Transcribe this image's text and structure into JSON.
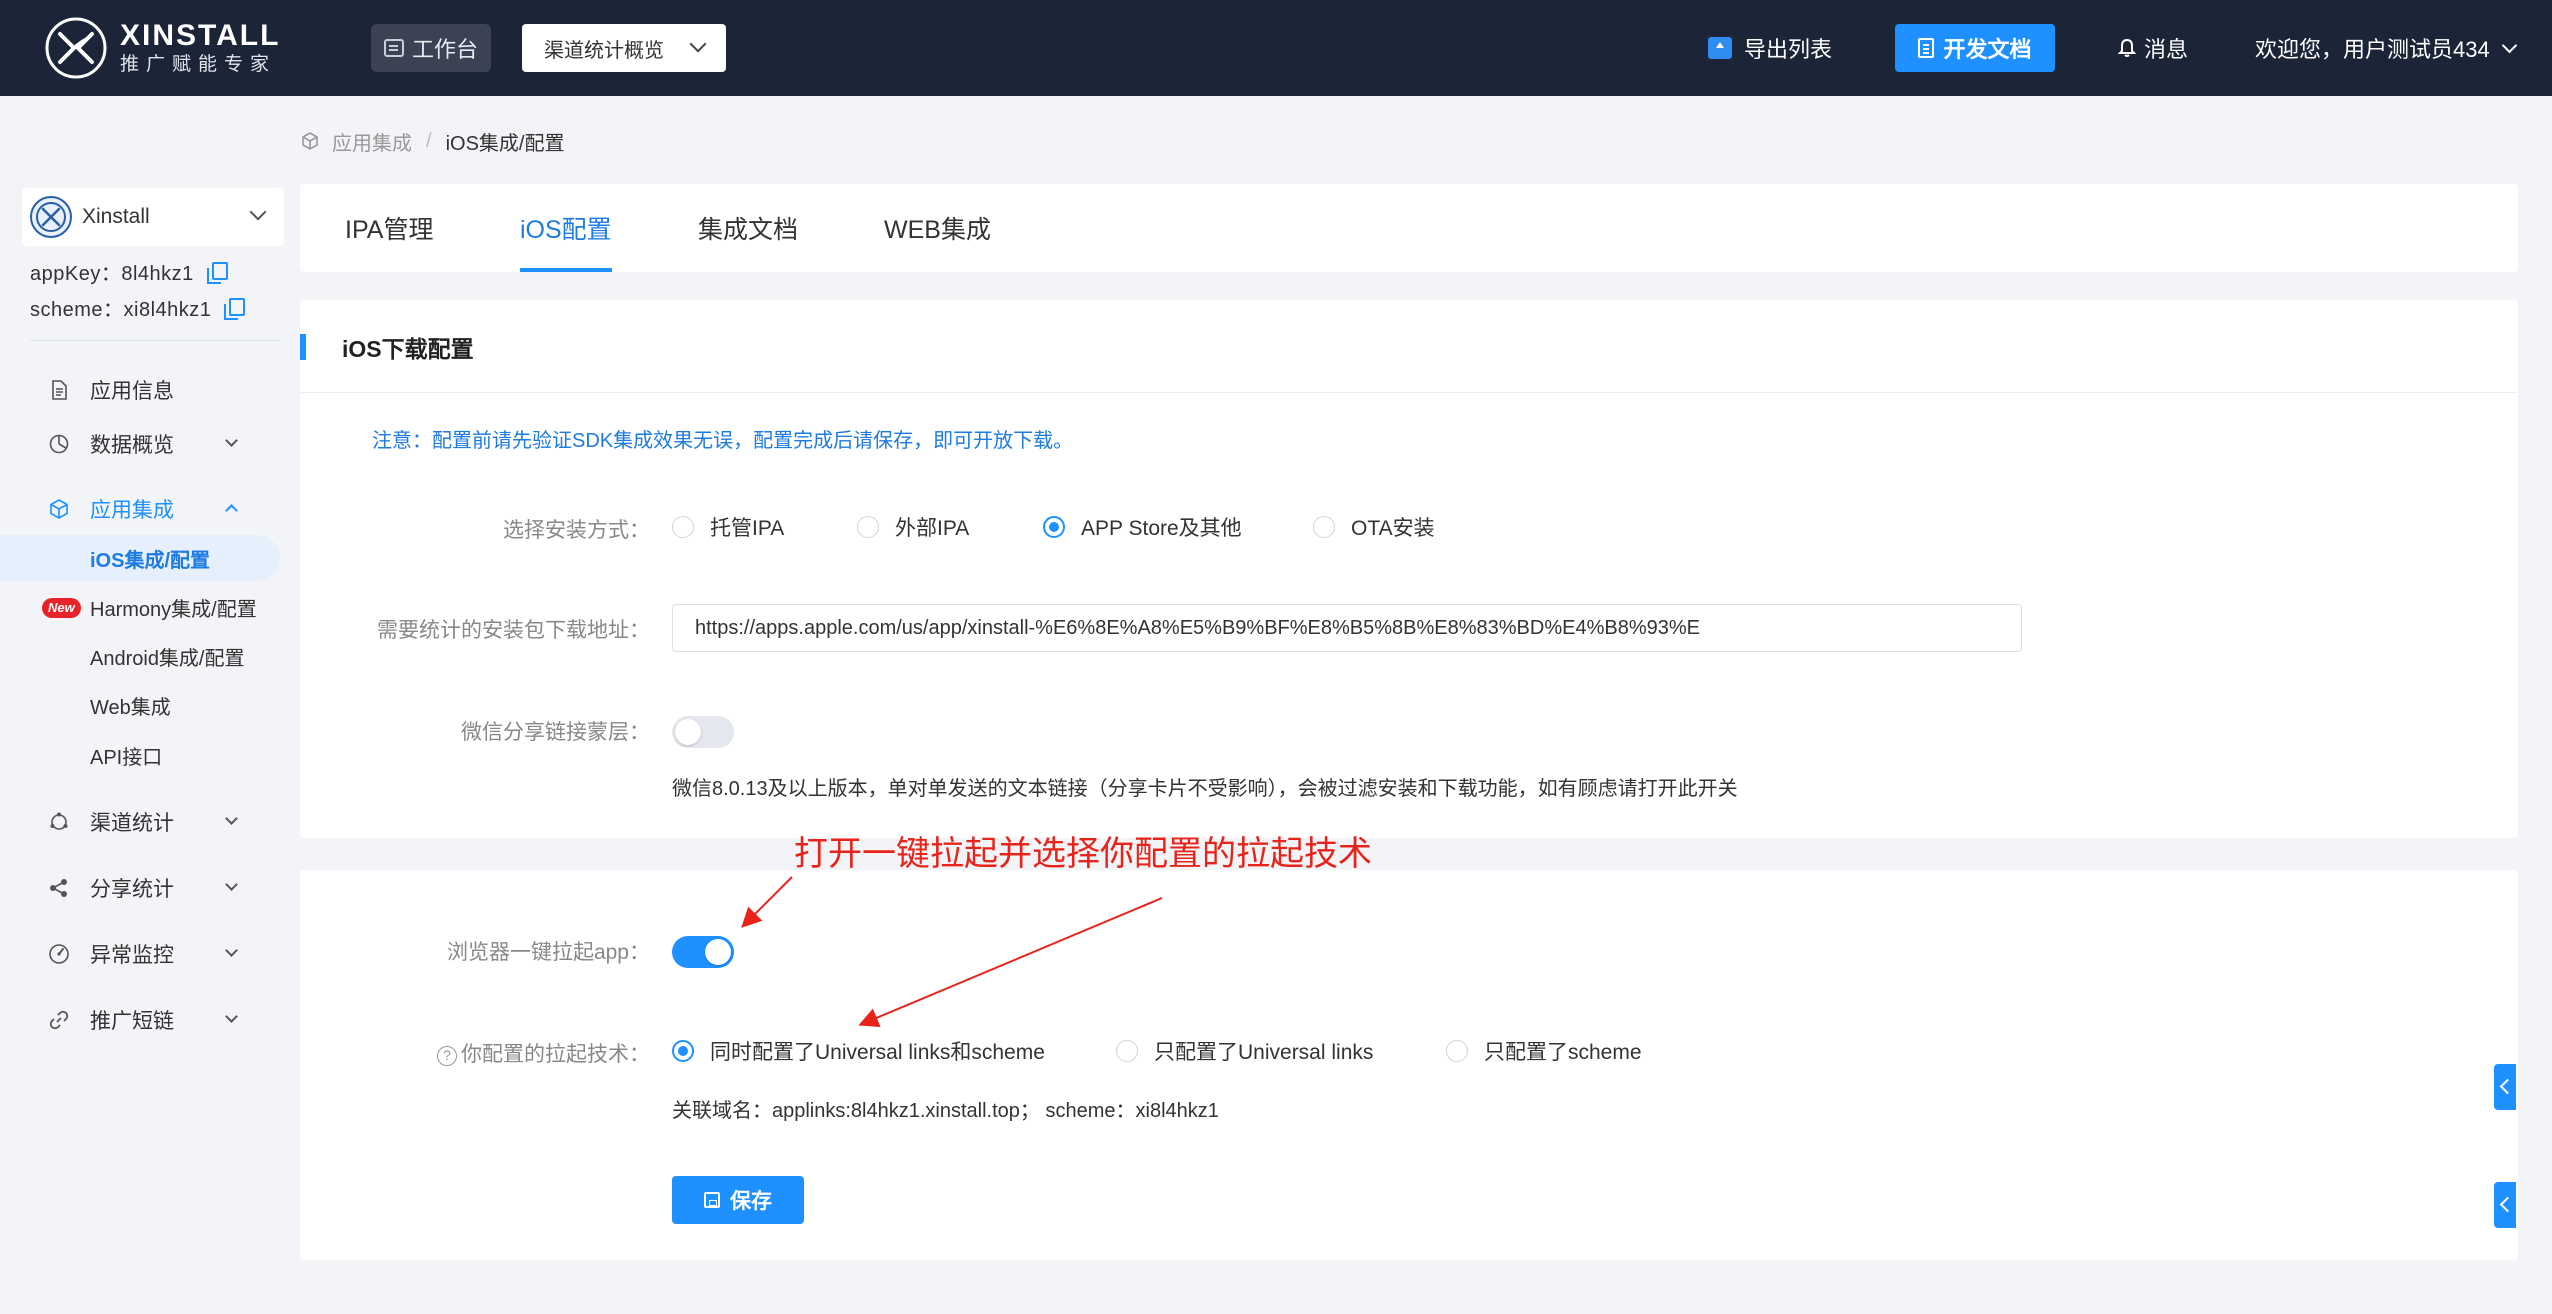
{
  "header": {
    "logo_title": "XINSTALL",
    "logo_subtitle": "推广赋能专家",
    "workbench_label": "工作台",
    "channel_select_value": "渠道统计概览",
    "export_label": "导出列表",
    "devdoc_label": "开发文档",
    "message_label": "消息",
    "welcome_label": "欢迎您，用户测试员434"
  },
  "breadcrumb": {
    "parent": "应用集成",
    "separator": "/",
    "current": "iOS集成/配置"
  },
  "sidebar": {
    "app_name": "Xinstall",
    "app_key": "appKey：8l4hkz1",
    "scheme": "scheme：xi8l4hkz1",
    "nav": [
      {
        "label": "应用信息",
        "icon": "document-icon"
      },
      {
        "label": "数据概览",
        "icon": "pie-chart-icon"
      },
      {
        "label": "应用集成",
        "icon": "cube-icon"
      },
      {
        "label": "渠道统计",
        "icon": "cycle-icon"
      },
      {
        "label": "分享统计",
        "icon": "share-icon"
      },
      {
        "label": "异常监控",
        "icon": "gauge-icon"
      },
      {
        "label": "推广短链",
        "icon": "link-icon"
      }
    ],
    "sub_items": [
      {
        "label": "iOS集成/配置"
      },
      {
        "label": "Harmony集成/配置",
        "badge": "New"
      },
      {
        "label": "Android集成/配置"
      },
      {
        "label": "Web集成"
      },
      {
        "label": "API接口"
      }
    ]
  },
  "tabs": [
    "IPA管理",
    "iOS配置",
    "集成文档",
    "WEB集成"
  ],
  "download_config": {
    "title": "iOS下载配置",
    "notice": "注意：配置前请先验证SDK集成效果无误，配置完成后请保存，即可开放下载。",
    "install_method_label": "选择安装方式：",
    "install_options": [
      "托管IPA",
      "外部IPA",
      "APP Store及其他",
      "OTA安装"
    ],
    "selected_install_option": "APP Store及其他",
    "download_url_label": "需要统计的安装包下载地址：",
    "download_url_value": "https://apps.apple.com/us/app/xinstall-%E6%8E%A8%E5%B9%BF%E8%B5%8B%E8%83%BD%E4%B8%93%E",
    "wechat_mask_label": "微信分享链接蒙层：",
    "wechat_mask_enabled": false,
    "wechat_hint": "微信8.0.13及以上版本，单对单发送的文本链接（分享卡片不受影响），会被过滤安装和下载功能，如有顾虑请打开此开关"
  },
  "launch_config": {
    "browser_launch_label": "浏览器一键拉起app：",
    "browser_launch_enabled": true,
    "tech_label": "你配置的拉起技术：",
    "tech_options": [
      "同时配置了Universal links和scheme",
      "只配置了Universal links",
      "只配置了scheme"
    ],
    "selected_tech_option": "同时配置了Universal links和scheme",
    "domain_line": "关联域名：applinks:8l4hkz1.xinstall.top；  scheme：xi8l4hkz1",
    "save_label": "保存"
  },
  "annotation": {
    "text": "打开一键拉起并选择你配置的拉起技术",
    "color": "#e8231a"
  },
  "colors": {
    "header_bg": "#1c2438",
    "accent": "#1e90ff",
    "page_bg": "#f2f4f7"
  }
}
